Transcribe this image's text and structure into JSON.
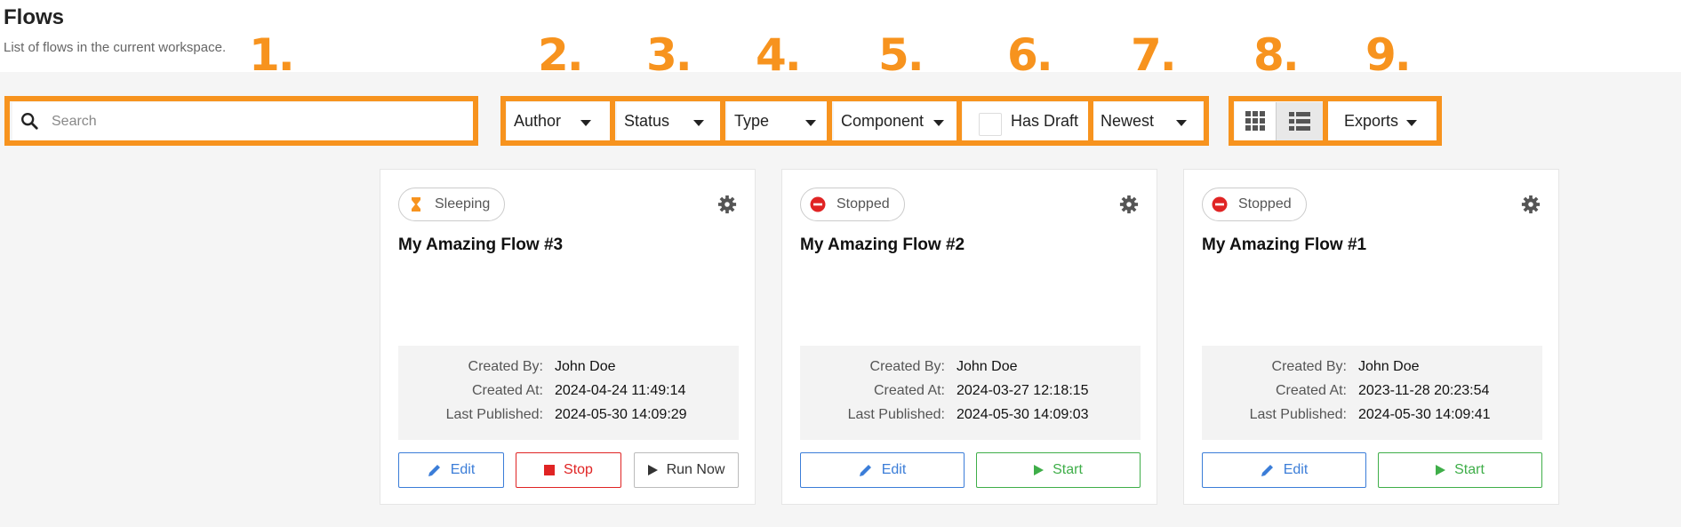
{
  "header": {
    "title": "Flows",
    "subtitle": "List of flows in the current workspace."
  },
  "callouts": [
    "1.",
    "2.",
    "3.",
    "4.",
    "5.",
    "6.",
    "7.",
    "8.",
    "9."
  ],
  "toolbar": {
    "search_placeholder": "Search",
    "author_label": "Author",
    "status_label": "Status",
    "type_label": "Type",
    "component_label": "Component",
    "has_draft_label": "Has Draft",
    "sort_label": "Newest",
    "grid_view_icon": "grid-icon",
    "list_view_icon": "list-icon",
    "exports_label": "Exports"
  },
  "labels": {
    "created_by": "Created By:",
    "created_at": "Created At:",
    "last_published": "Last Published:",
    "edit": "Edit",
    "stop": "Stop",
    "run_now": "Run Now",
    "start": "Start"
  },
  "colors": {
    "callout": "#f7931e",
    "sleeping": "#f7931e",
    "stopped": "#e02424",
    "edit": "#3b7dd8",
    "start": "#3fae49"
  },
  "flows": [
    {
      "status": "Sleeping",
      "status_icon": "hourglass-icon",
      "name": "My Amazing Flow #3",
      "created_by": "John Doe",
      "created_at": "2024-04-24 11:49:14",
      "last_published": "2024-05-30 14:09:29"
    },
    {
      "status": "Stopped",
      "status_icon": "stop-circle-icon",
      "name": "My Amazing Flow #2",
      "created_by": "John Doe",
      "created_at": "2024-03-27 12:18:15",
      "last_published": "2024-05-30 14:09:03"
    },
    {
      "status": "Stopped",
      "status_icon": "stop-circle-icon",
      "name": "My Amazing Flow #1",
      "created_by": "John Doe",
      "created_at": "2023-11-28 20:23:54",
      "last_published": "2024-05-30 14:09:41"
    }
  ]
}
